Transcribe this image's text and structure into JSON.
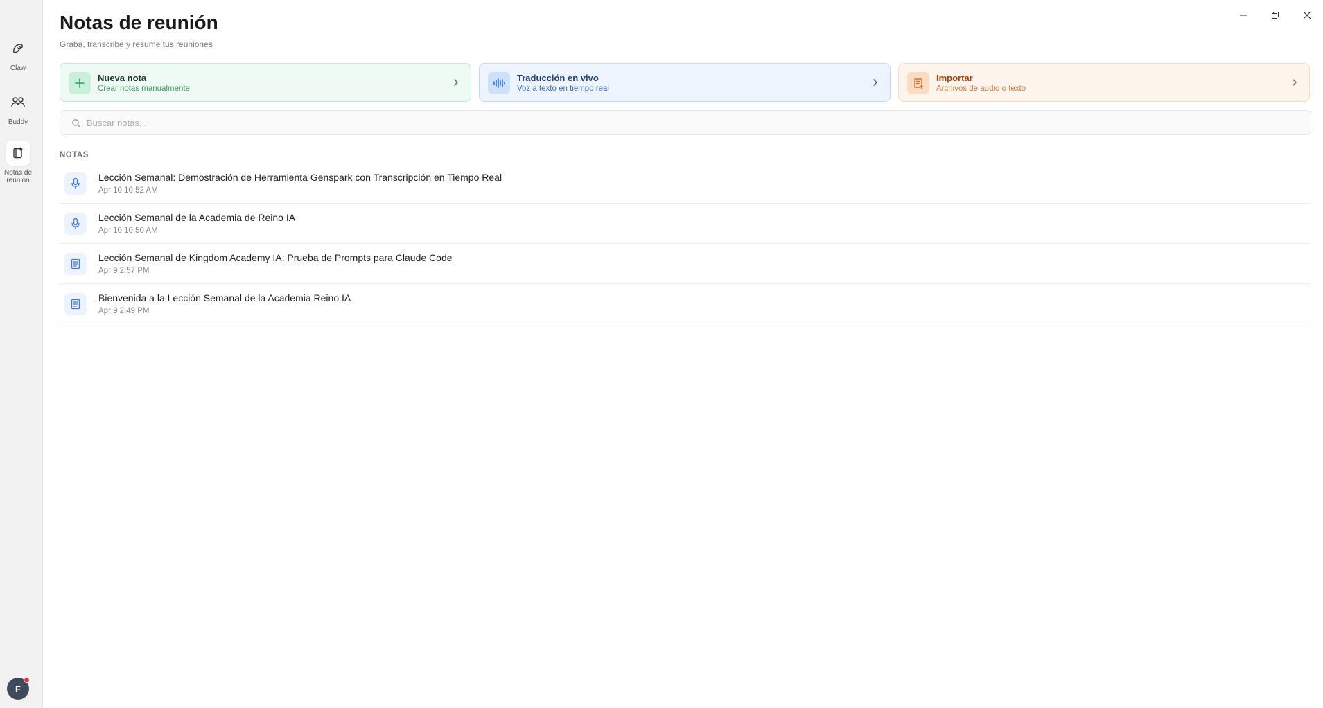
{
  "sidebar": {
    "items": [
      {
        "label": "Claw",
        "icon": "claw-icon"
      },
      {
        "label": "Buddy",
        "icon": "buddy-icon"
      },
      {
        "label": "Notas de reunión",
        "icon": "meeting-notes-icon"
      }
    ],
    "active_index": 2,
    "avatar": {
      "initial": "F",
      "notification": true
    }
  },
  "header": {
    "title": "Notas de reunión",
    "subtitle": "Graba, transcribe y resume tus reuniones"
  },
  "actions": [
    {
      "title": "Nueva nota",
      "subtitle": "Crear notas manualmente",
      "icon": "plus-icon",
      "color": "#2e9e5b"
    },
    {
      "title": "Traducción en vivo",
      "subtitle": "Voz a texto en tiempo real",
      "icon": "audio-wave-icon",
      "color": "#2f6fd6"
    },
    {
      "title": "Importar",
      "subtitle": "Archivos de audio o texto",
      "icon": "import-file-icon",
      "color": "#d9702b"
    }
  ],
  "search": {
    "placeholder": "Buscar notas..."
  },
  "notes_section": {
    "label": "NOTAS",
    "items": [
      {
        "title": "Lección Semanal: Demostración de Herramienta Genspark con Transcripción en Tiempo Real",
        "date": "Apr 10 10:52 AM",
        "icon": "microphone-icon"
      },
      {
        "title": "Lección Semanal de la Academia de Reino IA",
        "date": "Apr 10 10:50 AM",
        "icon": "microphone-icon"
      },
      {
        "title": "Lección Semanal de Kingdom Academy IA: Prueba de Prompts para Claude Code",
        "date": "Apr 9 2:57 PM",
        "icon": "document-icon"
      },
      {
        "title": "Bienvenida a la Lección Semanal de la Academia Reino IA",
        "date": "Apr 9 2:49 PM",
        "icon": "document-icon"
      }
    ]
  },
  "colors": {
    "accent_blue": "#3a7be0",
    "sidebar_bg": "#f2f2f2"
  }
}
